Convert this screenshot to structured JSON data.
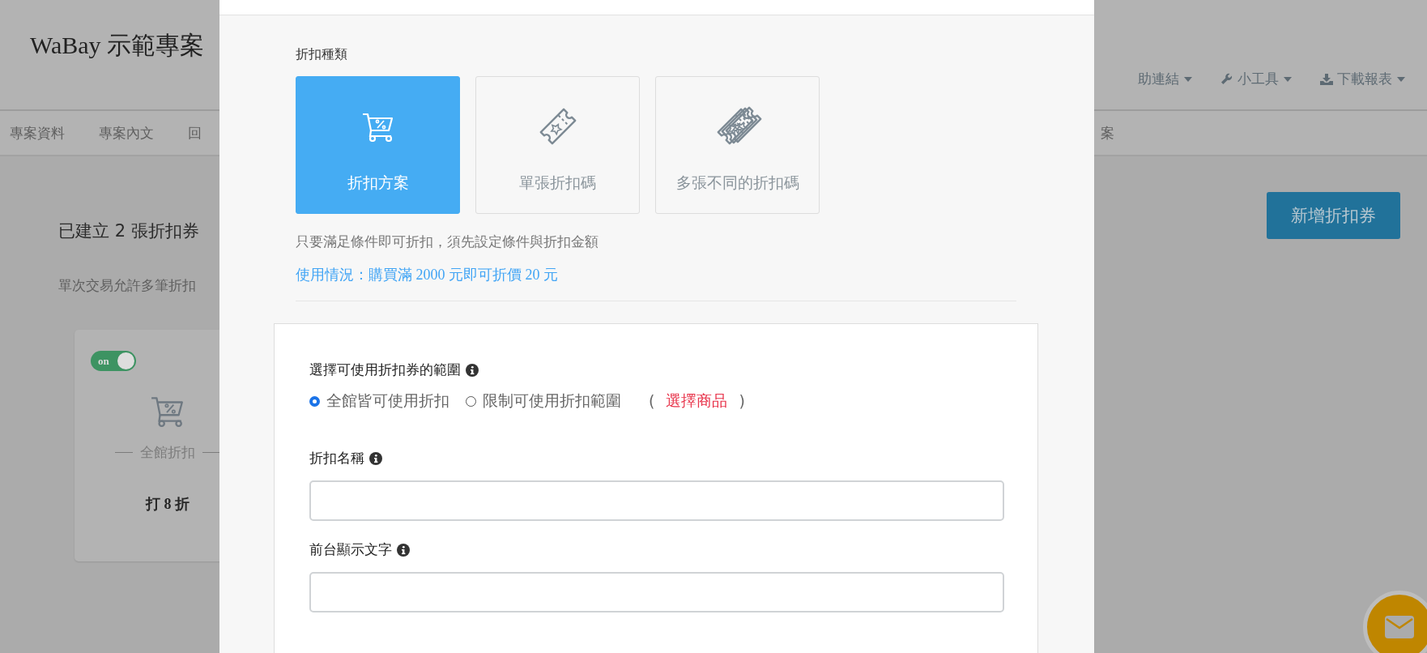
{
  "page": {
    "title": "WaBay 示範專案",
    "nav_menu": [
      {
        "label": "助連結",
        "kind": "plain"
      },
      {
        "label": "小工具",
        "kind": "tools"
      },
      {
        "label": "下載報表",
        "kind": "download"
      }
    ],
    "tabs": [
      "專案資料",
      "專案內文",
      "回"
    ],
    "tab_tail": "案",
    "heading": "已建立 2 張折扣券",
    "note": "單次交易允許多筆折扣",
    "add_button": "新增折扣券",
    "coupon_card": {
      "switch_label": "on",
      "on": true,
      "scope": "全館折扣",
      "discount": "打 8 折"
    }
  },
  "modal": {
    "type_label": "折扣種類",
    "types": [
      {
        "kind": "cart",
        "label": "折扣方案",
        "selected": true
      },
      {
        "kind": "ticket",
        "label": "單張折扣碼",
        "selected": false
      },
      {
        "kind": "tickets",
        "label": "多張不同的折扣碼",
        "selected": false
      }
    ],
    "description": "只要滿足條件即可折扣，須先設定條件與折扣金額",
    "usage": "使用情況：購買滿 2000 元即可折價 20 元",
    "scope": {
      "label": "選擇可使用折扣券的範圍",
      "options": [
        {
          "label": "全館皆可使用折扣",
          "selected": true
        },
        {
          "label": "限制可使用折扣範圍",
          "selected": false
        }
      ],
      "bracket_open": "(",
      "link": "選擇商品",
      "bracket_close": ")"
    },
    "fields": [
      {
        "label": "折扣名稱"
      },
      {
        "label": "前台顯示文字"
      }
    ]
  }
}
